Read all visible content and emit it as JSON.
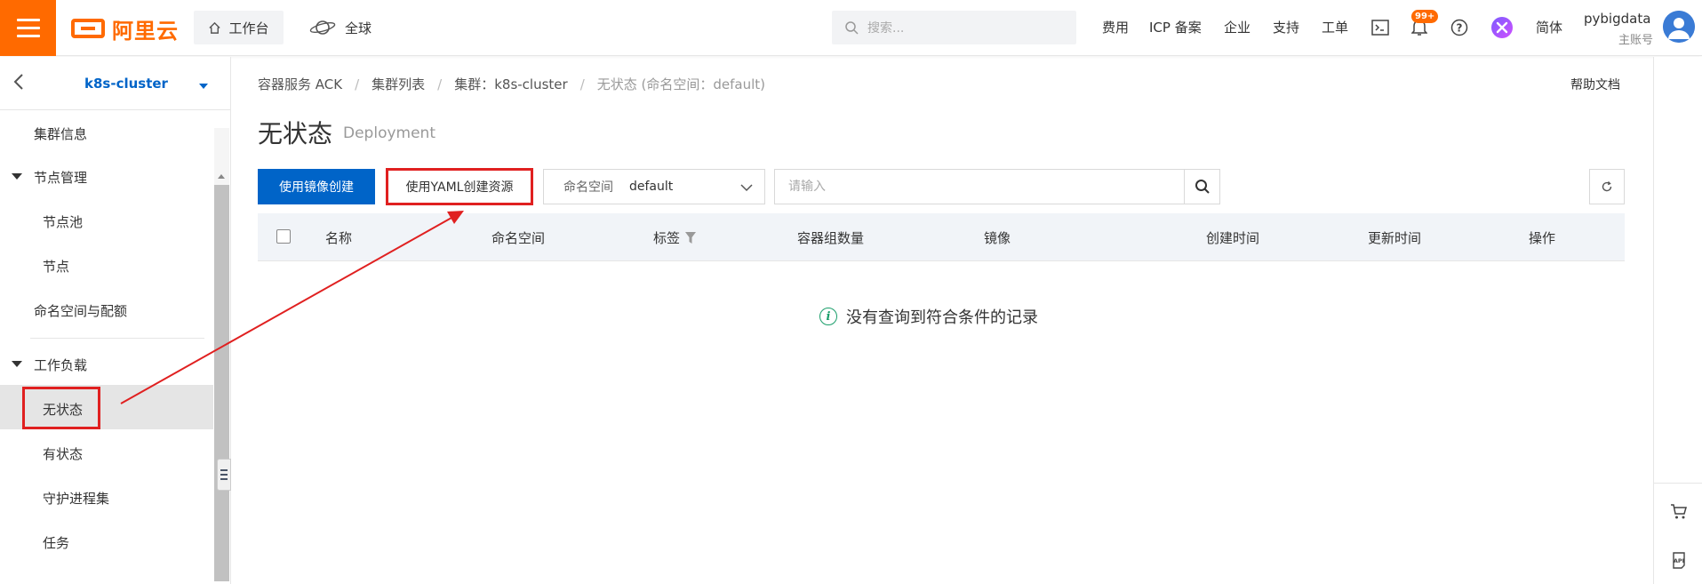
{
  "topbar": {
    "logo_text": "阿里云",
    "workbench_label": "工作台",
    "global_label": "全球",
    "search_placeholder": "搜索...",
    "links": [
      "费用",
      "ICP 备案",
      "企业",
      "支持",
      "工单"
    ],
    "notification_badge": "99+",
    "language_label": "简体",
    "user_name": "pybigdata",
    "user_role": "主账号"
  },
  "sidebar": {
    "cluster_name": "k8s-cluster",
    "items": [
      {
        "label": "集群信息"
      },
      {
        "label": "节点管理"
      },
      {
        "label": "节点池"
      },
      {
        "label": "节点"
      },
      {
        "label": "命名空间与配额"
      },
      {
        "label": "工作负载"
      },
      {
        "label": "无状态"
      },
      {
        "label": "有状态"
      },
      {
        "label": "守护进程集"
      },
      {
        "label": "任务"
      }
    ]
  },
  "breadcrumb": [
    "容器服务 ACK",
    "集群列表",
    "集群：k8s-cluster",
    "无状态 (命名空间：default)"
  ],
  "help_doc_label": "帮助文档",
  "page": {
    "title": "无状态",
    "subtitle": "Deployment"
  },
  "toolbar": {
    "create_image_label": "使用镜像创建",
    "create_yaml_label": "使用YAML创建资源",
    "namespace_label": "命名空间",
    "namespace_value": "default",
    "filter_placeholder": "请输入"
  },
  "table": {
    "columns": [
      "名称",
      "命名空间",
      "标签",
      "容器组数量",
      "镜像",
      "创建时间",
      "更新时间",
      "操作"
    ],
    "empty_message": "没有查询到符合条件的记录"
  },
  "colors": {
    "brand_orange": "#ff6a00",
    "primary_blue": "#0064c8",
    "annotation_red": "#e02020"
  }
}
